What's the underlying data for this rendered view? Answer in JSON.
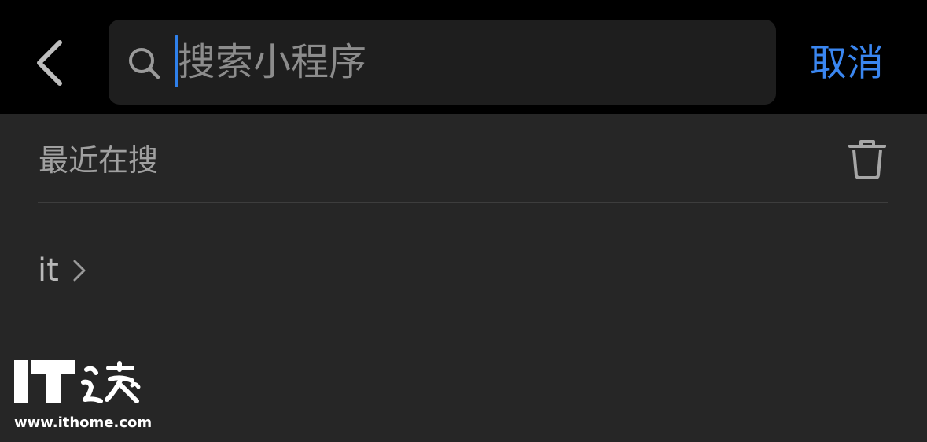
{
  "header": {
    "search": {
      "placeholder": "搜索小程序",
      "value": ""
    },
    "cancel_label": "取消"
  },
  "history": {
    "title": "最近在搜",
    "items": [
      {
        "label": "it"
      }
    ]
  },
  "watermark": {
    "logo_text": "IT之家",
    "url": "www.ithome.com"
  },
  "colors": {
    "top_bar": "#000000",
    "search_box": "#1e1e1e",
    "page_background": "#262626",
    "accent": "#3a86f0",
    "caret": "#2f80ea"
  },
  "icons": {
    "back": "chevron-left-icon",
    "search": "search-icon",
    "clear_history": "trash-icon",
    "history_item": "chevron-right-icon"
  }
}
